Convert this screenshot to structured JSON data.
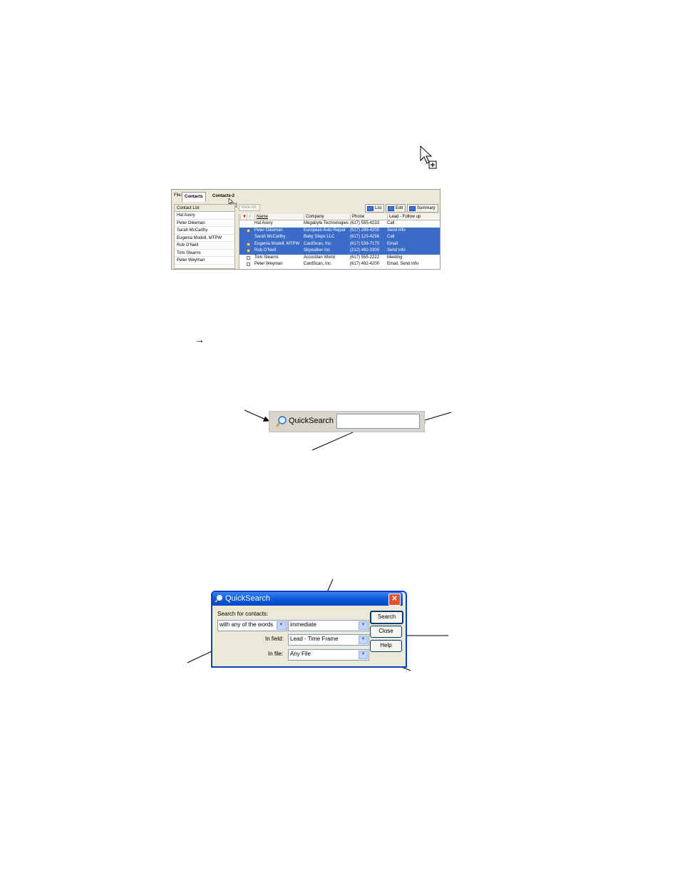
{
  "contacts_window": {
    "file_label": "File:",
    "tabs": [
      "Contacts",
      "Contacts-2"
    ],
    "contact_list_header": "Contact List",
    "contact_list": [
      "Hal Avery",
      "Peter Dikeman",
      "Sarah McCarthy",
      "Eugenia Modell, MTPW",
      "Rob O'Neill",
      "Tom Stearns",
      "Peter Weyman"
    ],
    "view_all_label": "View All",
    "view_buttons": [
      "List",
      "Edit",
      "Summary"
    ],
    "columns": [
      "Name",
      "Company",
      "Phone",
      "Lead - Follow up"
    ],
    "rows": [
      {
        "name": "Hal Avery",
        "company": "Megabyte Technologies",
        "phone": "(617) 555-4233",
        "follow_up": "Call",
        "selected": false,
        "icon": false
      },
      {
        "name": "Peter Dikeman",
        "company": "European Auto Repair",
        "phone": "(617) 299-4200",
        "follow_up": "Send Info",
        "selected": true,
        "icon": true
      },
      {
        "name": "Sarah McCarthy",
        "company": "Baby Steps LLC",
        "phone": "(617) 123-4256",
        "follow_up": "Call",
        "selected": true,
        "icon": false
      },
      {
        "name": "Eugenia Modell, MTPW",
        "company": "CardScan, Inc.",
        "phone": "(617) 538-7170",
        "follow_up": "Email",
        "selected": true,
        "icon": true
      },
      {
        "name": "Rob O'Neill",
        "company": "Skywalker Inc",
        "phone": "(212) 492-0300",
        "follow_up": "Send Info",
        "selected": true,
        "icon": true
      },
      {
        "name": "Tom Stearns",
        "company": "Accordian World",
        "phone": "(617) 555-2222",
        "follow_up": "Meeting",
        "selected": false,
        "icon": true
      },
      {
        "name": "Peter Weyman",
        "company": "CardScan, Inc.",
        "phone": "(617) 492-4200",
        "follow_up": "Email, Send Info",
        "selected": false,
        "icon": true
      }
    ]
  },
  "body_text": {
    "arrow_glyph": "→"
  },
  "quicksearch_bar": {
    "label": "QuickSearch",
    "input_value": "",
    "dropdown_glyph": "▼"
  },
  "quicksearch_dialog": {
    "title": "QuickSearch",
    "close_glyph": "✕",
    "search_for_label": "Search for contacts:",
    "match_mode": "with any of the words",
    "search_text": "immediate",
    "in_field_label": "In field:",
    "in_field_value": "Lead - Time Frame",
    "in_file_label": "In file:",
    "in_file_value": "Any File",
    "buttons": [
      "Search",
      "Close",
      "Help"
    ]
  },
  "colors": {
    "selection": "#3b6cc7",
    "titlebar": "#0a5ad8",
    "window_bg": "#ece9d8"
  }
}
